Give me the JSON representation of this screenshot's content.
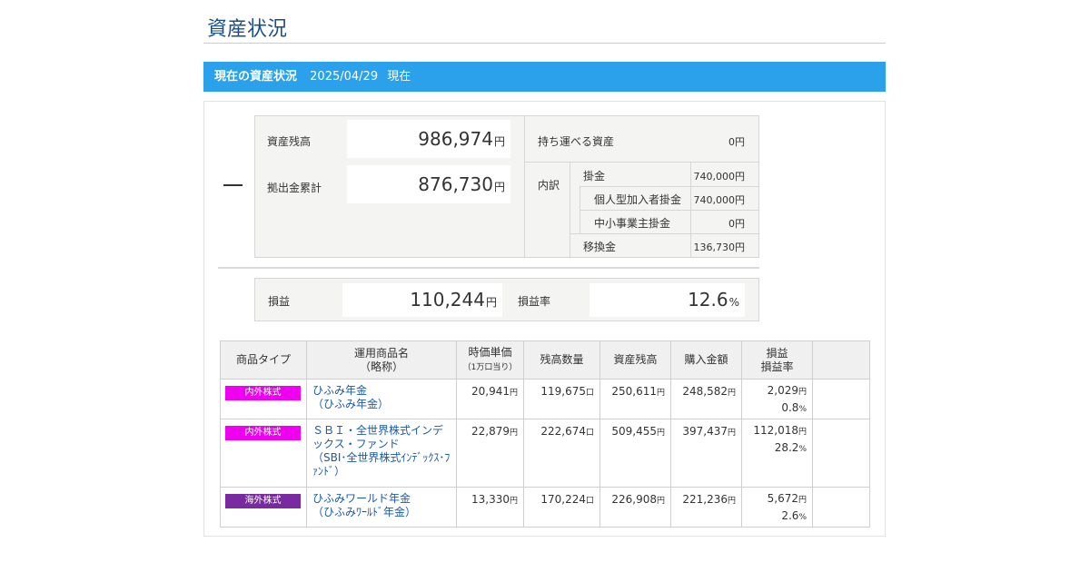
{
  "page": {
    "title": "資産状況"
  },
  "banner": {
    "label": "現在の資産状況",
    "date": "2025/04/29",
    "suffix": "現在"
  },
  "summary": {
    "dash": "—",
    "balance": {
      "label": "資産残高",
      "value": "986,974",
      "unit": "円"
    },
    "contrib": {
      "label": "拠出金累計",
      "value": "876,730",
      "unit": "円"
    },
    "portable": {
      "label": "持ち運べる資産",
      "value": "0円"
    },
    "breakdown": {
      "label": "内訳",
      "rows": [
        {
          "label": "掛金",
          "value": "740,000円"
        },
        {
          "label": "個人型加入者掛金",
          "value": "740,000円"
        },
        {
          "label": "中小事業主掛金",
          "value": "0円"
        },
        {
          "label": "移換金",
          "value": "136,730円"
        }
      ]
    },
    "profit": {
      "label": "損益",
      "value": "110,244",
      "unit": "円"
    },
    "rate": {
      "label": "損益率",
      "value": "12.6",
      "unit": "%"
    }
  },
  "table": {
    "headers": [
      {
        "l1": "商品タイプ",
        "l2": ""
      },
      {
        "l1": "運用商品名",
        "l2": "（略称）"
      },
      {
        "l1": "時価単価",
        "l2": "（1万口当り）"
      },
      {
        "l1": "残高数量",
        "l2": ""
      },
      {
        "l1": "資産残高",
        "l2": ""
      },
      {
        "l1": "購入金額",
        "l2": ""
      },
      {
        "l1": "損益",
        "l2": "損益率"
      },
      {
        "l1": "",
        "l2": ""
      }
    ],
    "rows": [
      {
        "type": "内外株式",
        "color": "#f000f0",
        "name": "ひふみ年金",
        "short": "（ひふみ年金）",
        "price": "20,941",
        "qty": "119,675",
        "bal": "250,611",
        "buy": "248,582",
        "pl": "2,029",
        "rate": "0.8"
      },
      {
        "type": "内外株式",
        "color": "#f000f0",
        "name": "ＳＢＩ・全世界株式インデックス・ファンド",
        "short": "（SBI･全世界株式ｲﾝﾃﾞｯｸｽ･ﾌｧﾝﾄﾞ）",
        "price": "22,879",
        "qty": "222,674",
        "bal": "509,455",
        "buy": "397,437",
        "pl": "112,018",
        "rate": "28.2"
      },
      {
        "type": "海外株式",
        "color": "#7a2aa0",
        "name": "ひふみワールド年金",
        "short": "（ひふみﾜｰﾙﾄﾞ年金）",
        "price": "13,330",
        "qty": "170,224",
        "bal": "226,908",
        "buy": "221,236",
        "pl": "5,672",
        "rate": "2.6"
      }
    ],
    "units": {
      "yen": "円",
      "kuchi": "口",
      "pct": "%"
    }
  }
}
